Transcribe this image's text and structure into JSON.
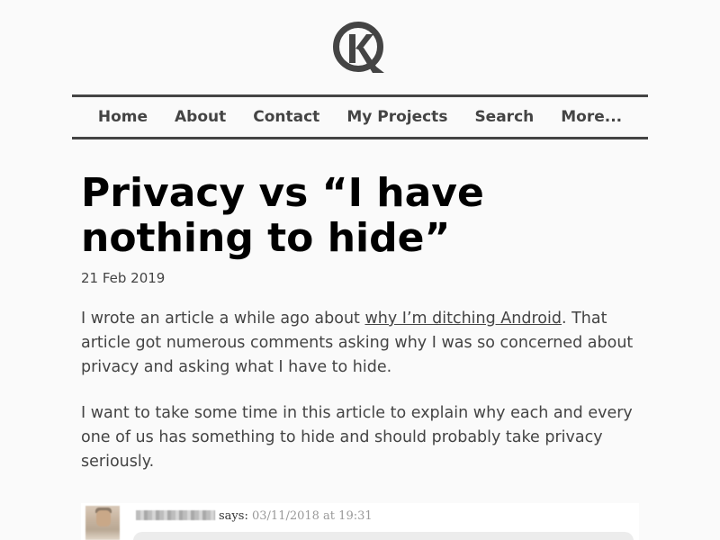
{
  "site": {
    "logo_icon": "k-circle-logo-icon",
    "brand_color": "#444444"
  },
  "nav": {
    "items": [
      {
        "label": "Home"
      },
      {
        "label": "About"
      },
      {
        "label": "Contact"
      },
      {
        "label": "My Projects"
      },
      {
        "label": "Search"
      },
      {
        "label": "More..."
      }
    ]
  },
  "post": {
    "title": "Privacy vs “I have nothing to hide”",
    "date": "21 Feb 2019",
    "para1": {
      "before": "I wrote an article a while ago about ",
      "link": "why I’m ditching Android",
      "after": ". That article got numerous comments asking why I was so concerned about privacy and asking what I have to hide."
    },
    "para2": "I want to take some time in this article to explain why each and every one of us has something to hide and should probably take privacy seriously."
  },
  "comment": {
    "says": "says:",
    "timestamp": "03/11/2018 at 19:31"
  }
}
